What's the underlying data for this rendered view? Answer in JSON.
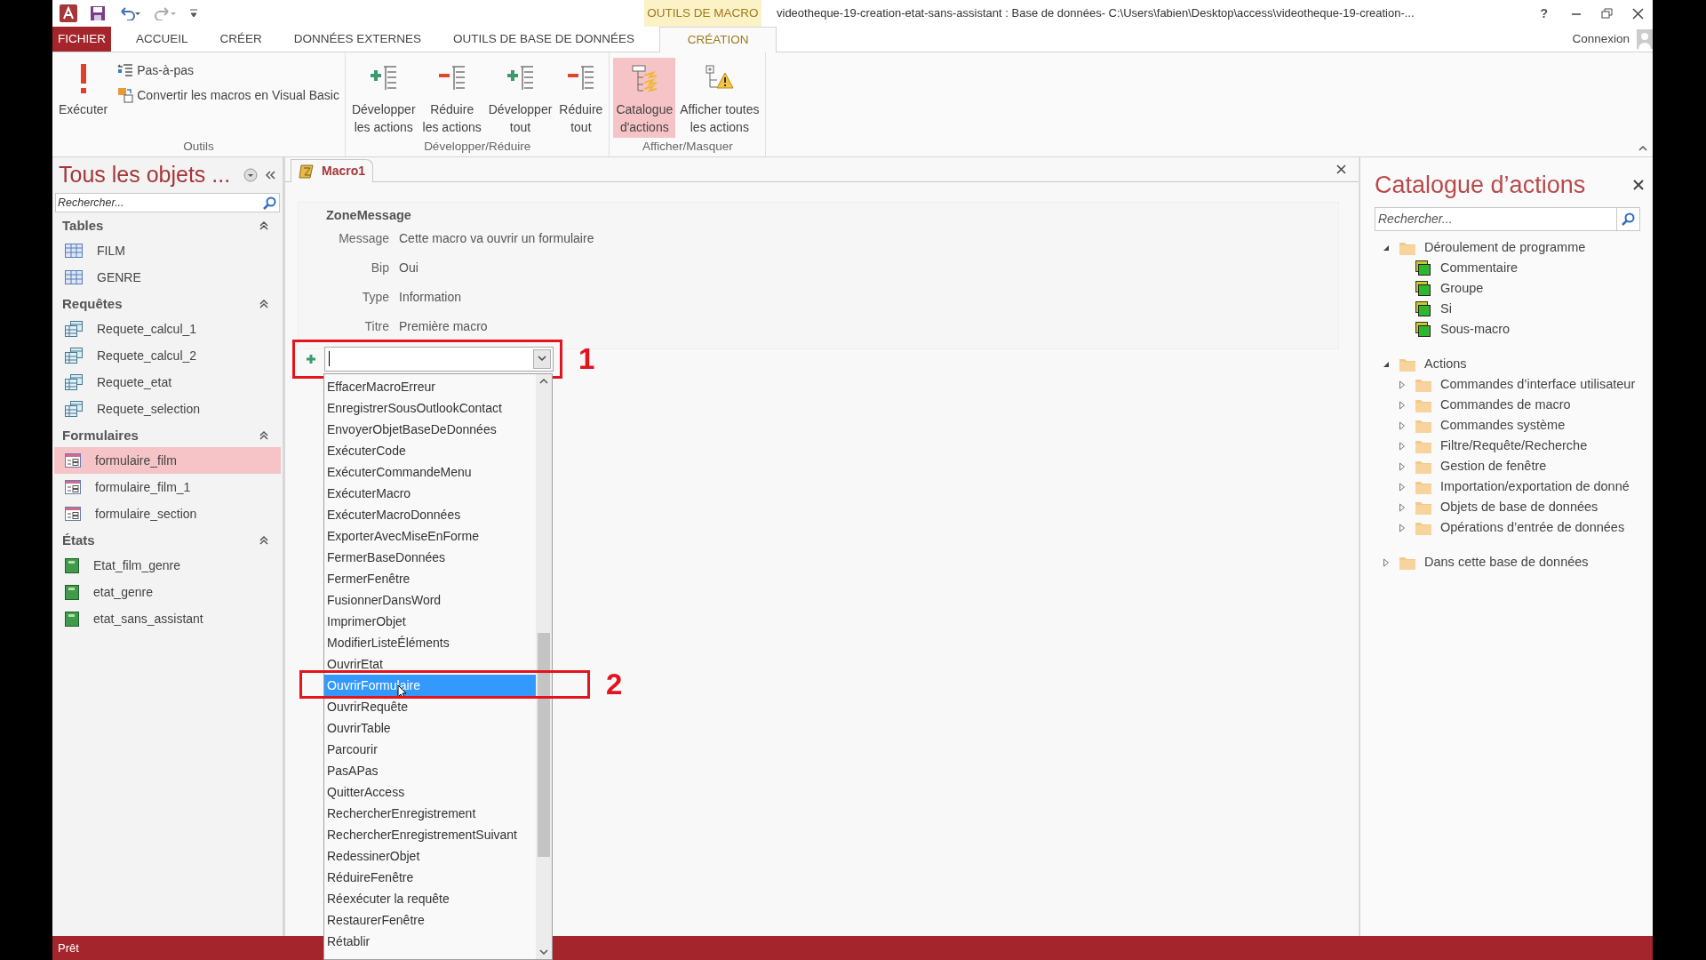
{
  "title_bar": {
    "context_tab": "OUTILS DE MACRO",
    "title": "videotheque-19-creation-etat-sans-assistant : Base de données- C:\\Users\\fabien\\Desktop\\access\\videotheque-19-creation-...",
    "help": "?"
  },
  "ribbon_tabs": [
    {
      "label": "FICHIER",
      "kind": "file",
      "selected": false
    },
    {
      "label": "ACCUEIL",
      "kind": "tab",
      "selected": false
    },
    {
      "label": "CRÉER",
      "kind": "tab",
      "selected": false
    },
    {
      "label": "DONNÉES EXTERNES",
      "kind": "tab",
      "selected": false
    },
    {
      "label": "OUTILS DE BASE DE DONNÉES",
      "kind": "tab",
      "selected": false
    },
    {
      "label": "CRÉATION",
      "kind": "tab",
      "selected": true
    }
  ],
  "account": "Connexion",
  "ribbon_groups": [
    {
      "label": "Outils",
      "buttons": [
        {
          "label": "Exécuter",
          "kind": "large",
          "selected": false
        },
        {
          "label": "Pas-à-pas",
          "kind": "small",
          "selected": false
        },
        {
          "label": "Convertir les macros en Visual Basic",
          "kind": "small",
          "selected": false
        }
      ]
    },
    {
      "label": "Développer/Réduire",
      "buttons": [
        {
          "label": "Développer\nles actions",
          "kind": "large",
          "selected": false
        },
        {
          "label": "Réduire\nles actions",
          "kind": "large",
          "selected": false
        },
        {
          "label": "Développer\ntout",
          "kind": "large",
          "selected": false
        },
        {
          "label": "Réduire\ntout",
          "kind": "large",
          "selected": false
        }
      ]
    },
    {
      "label": "Afficher/Masquer",
      "buttons": [
        {
          "label": "Catalogue\nd'actions",
          "kind": "large",
          "selected": true
        },
        {
          "label": "Afficher toutes\nles actions",
          "kind": "large",
          "selected": false
        }
      ]
    }
  ],
  "navigation": {
    "title": "Tous les objets ...",
    "search_placeholder": "Rechercher...",
    "groups": [
      {
        "label": "Tables",
        "expanded": true,
        "items": [
          {
            "label": "FILM",
            "kind": "table",
            "selected": false
          },
          {
            "label": "GENRE",
            "kind": "table",
            "selected": false
          }
        ]
      },
      {
        "label": "Requêtes",
        "expanded": true,
        "items": [
          {
            "label": "Requete_calcul_1",
            "kind": "query",
            "selected": false
          },
          {
            "label": "Requete_calcul_2",
            "kind": "query",
            "selected": false
          },
          {
            "label": "Requete_etat",
            "kind": "query",
            "selected": false
          },
          {
            "label": "Requete_selection",
            "kind": "query",
            "selected": false
          }
        ]
      },
      {
        "label": "Formulaires",
        "expanded": true,
        "items": [
          {
            "label": "formulaire_film",
            "kind": "form",
            "selected": true
          },
          {
            "label": "formulaire_film_1",
            "kind": "form",
            "selected": false
          },
          {
            "label": "formulaire_section",
            "kind": "form",
            "selected": false
          }
        ]
      },
      {
        "label": "États",
        "expanded": true,
        "items": [
          {
            "label": "Etat_film_genre",
            "kind": "report",
            "selected": false
          },
          {
            "label": "etat_genre",
            "kind": "report",
            "selected": false
          },
          {
            "label": "etat_sans_assistant",
            "kind": "report",
            "selected": false
          }
        ]
      }
    ]
  },
  "document": {
    "tab": "Macro1",
    "action": {
      "name": "ZoneMessage",
      "arguments": [
        {
          "label": "Message",
          "value": "Cette macro va ouvrir un formulaire"
        },
        {
          "label": "Bip",
          "value": "Oui"
        },
        {
          "label": "Type",
          "value": "Information"
        },
        {
          "label": "Titre",
          "value": "Première macro"
        }
      ]
    },
    "new_action": {
      "annotation": "1"
    },
    "dropdown": [
      {
        "label": "EffacerMacroErreur",
        "selected": false
      },
      {
        "label": "EnregistrerSousOutlookContact",
        "selected": false
      },
      {
        "label": "EnvoyerObjetBaseDeDonnées",
        "selected": false
      },
      {
        "label": "ExécuterCode",
        "selected": false
      },
      {
        "label": "ExécuterCommandeMenu",
        "selected": false
      },
      {
        "label": "ExécuterMacro",
        "selected": false
      },
      {
        "label": "ExécuterMacroDonnées",
        "selected": false
      },
      {
        "label": "ExporterAvecMiseEnForme",
        "selected": false
      },
      {
        "label": "FermerBaseDonnées",
        "selected": false
      },
      {
        "label": "FermerFenêtre",
        "selected": false
      },
      {
        "label": "FusionnerDansWord",
        "selected": false
      },
      {
        "label": "ImprimerObjet",
        "selected": false
      },
      {
        "label": "ModifierListeÉléments",
        "selected": false
      },
      {
        "label": "OuvrirEtat",
        "selected": false
      },
      {
        "label": "OuvrirFormulaire",
        "selected": true,
        "annotation": "2"
      },
      {
        "label": "OuvrirRequête",
        "selected": false
      },
      {
        "label": "OuvrirTable",
        "selected": false
      },
      {
        "label": "Parcourir",
        "selected": false
      },
      {
        "label": "PasAPas",
        "selected": false
      },
      {
        "label": "QuitterAccess",
        "selected": false
      },
      {
        "label": "RechercherEnregistrement",
        "selected": false
      },
      {
        "label": "RechercherEnregistrementSuivant",
        "selected": false
      },
      {
        "label": "RedessinerObjet",
        "selected": false
      },
      {
        "label": "RéduireFenêtre",
        "selected": false
      },
      {
        "label": "Réexécuter la requête",
        "selected": false
      },
      {
        "label": "RestaurerFenêtre",
        "selected": false
      },
      {
        "label": "Rétablir",
        "selected": false
      }
    ]
  },
  "catalog": {
    "title": "Catalogue d’actions",
    "search_placeholder": "Rechercher...",
    "tree": [
      {
        "label": "Déroulement de programme",
        "kind": "folder",
        "expanded": true,
        "children": [
          {
            "label": "Commentaire",
            "kind": "flow"
          },
          {
            "label": "Groupe",
            "kind": "flow"
          },
          {
            "label": "Si",
            "kind": "flow"
          },
          {
            "label": "Sous-macro",
            "kind": "flow"
          }
        ]
      },
      {
        "label": "Actions",
        "kind": "folder",
        "expanded": true,
        "children": [
          {
            "label": "Commandes d’interface utilisateur",
            "kind": "folder",
            "expanded": false
          },
          {
            "label": "Commandes de macro",
            "kind": "folder",
            "expanded": false
          },
          {
            "label": "Commandes système",
            "kind": "folder",
            "expanded": false
          },
          {
            "label": "Filtre/Requête/Recherche",
            "kind": "folder",
            "expanded": false
          },
          {
            "label": "Gestion de fenêtre",
            "kind": "folder",
            "expanded": false
          },
          {
            "label": "Importation/exportation de donné",
            "kind": "folder",
            "expanded": false
          },
          {
            "label": "Objets de base de données",
            "kind": "folder",
            "expanded": false
          },
          {
            "label": "Opérations d’entrée de données",
            "kind": "folder",
            "expanded": false
          }
        ]
      },
      {
        "label": "Dans cette base de données",
        "kind": "folder",
        "expanded": false
      }
    ]
  },
  "status_bar": {
    "text": "Prêt"
  }
}
